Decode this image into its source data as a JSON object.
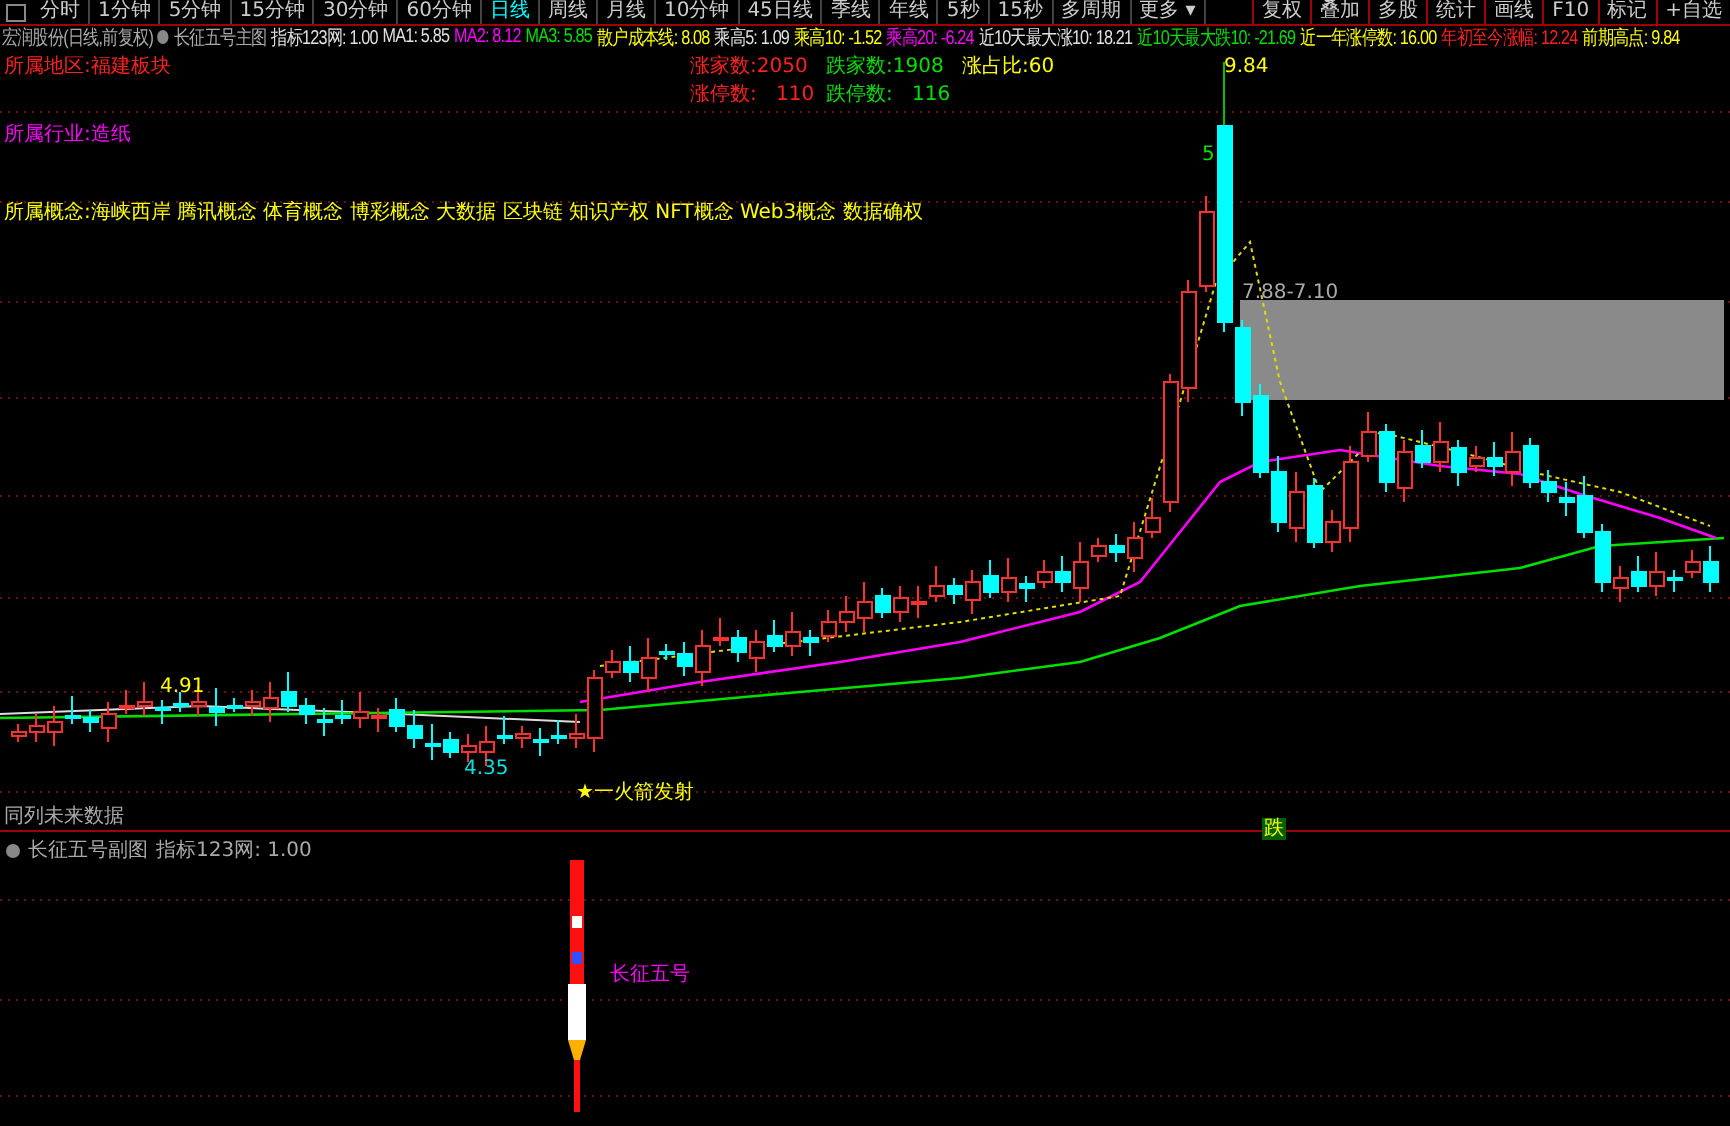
{
  "toolbar": {
    "periods": [
      {
        "label": "分时",
        "selected": false
      },
      {
        "label": "1分钟",
        "selected": false
      },
      {
        "label": "5分钟",
        "selected": false
      },
      {
        "label": "15分钟",
        "selected": false
      },
      {
        "label": "30分钟",
        "selected": false
      },
      {
        "label": "60分钟",
        "selected": false
      },
      {
        "label": "日线",
        "selected": true
      },
      {
        "label": "周线",
        "selected": false
      },
      {
        "label": "月线",
        "selected": false
      },
      {
        "label": "10分钟",
        "selected": false
      },
      {
        "label": "45日线",
        "selected": false
      },
      {
        "label": "季线",
        "selected": false
      },
      {
        "label": "年线",
        "selected": false
      },
      {
        "label": "5秒",
        "selected": false
      },
      {
        "label": "15秒",
        "selected": false
      },
      {
        "label": "多周期",
        "selected": false
      },
      {
        "label": "更多 ▾",
        "selected": false
      }
    ],
    "actions": [
      "复权",
      "叠加",
      "多股",
      "统计",
      "画线",
      "F10",
      "标记",
      "+自选"
    ]
  },
  "main_pane": {
    "title": "宏润股份(日线,前复权)",
    "indicator": "长征五号主图",
    "readouts": [
      {
        "text": "指标123网: 1.00",
        "color": "#e0e0e0"
      },
      {
        "text": "MA1: 5.85",
        "color": "#e0e0e0"
      },
      {
        "text": "MA2: 8.12",
        "color": "#ff00ff"
      },
      {
        "text": "MA3: 5.85",
        "color": "#00e000"
      },
      {
        "text": "散户成本线: 8.08",
        "color": "#ffff00"
      },
      {
        "text": "乘高5: 1.09",
        "color": "#e0e0e0"
      },
      {
        "text": "乘高10: -1.52",
        "color": "#ffff00"
      },
      {
        "text": "乘高20: -6.24",
        "color": "#ff00ff"
      },
      {
        "text": "近10天最大涨10: 18.21",
        "color": "#e0e0e0"
      },
      {
        "text": "近10天最大跌10: -21.69",
        "color": "#00e000"
      },
      {
        "text": "近一年涨停数: 16.00",
        "color": "#ffff00"
      },
      {
        "text": "年初至今涨幅: 12.24",
        "color": "#ff2020"
      },
      {
        "text": "前期高点: 9.84",
        "color": "#ffff00"
      }
    ],
    "region": "所属地区:福建板块",
    "breadth": [
      {
        "text": "涨家数:2050",
        "color": "#ff2020"
      },
      {
        "text": "跌家数:1908",
        "color": "#00e000"
      },
      {
        "text": "涨占比:60",
        "color": "#ffff00"
      }
    ],
    "limits": [
      {
        "label": "涨停数:",
        "value": "110",
        "color": "#ff2020"
      },
      {
        "label": "跌停数:",
        "value": "116",
        "color": "#00e000"
      }
    ],
    "industry": "所属行业:造纸",
    "concepts": "所属概念:海峡西岸 腾讯概念 体育概念 博彩概念 大数据 区块链 知识产权 NFT概念 Web3概念 数据确权",
    "peak_label": "9.84",
    "wave_label": "5",
    "range_label": "7.88-7.10",
    "high_label": "4.91",
    "low_label": "4.35",
    "signal_label": "★一火箭发射",
    "future_note": "同列未来数据",
    "fall_badge": "跌"
  },
  "sub_pane": {
    "indicator": "长征五号副图",
    "readout": "指标123网: 1.00",
    "rocket_label": "长征五号"
  }
}
